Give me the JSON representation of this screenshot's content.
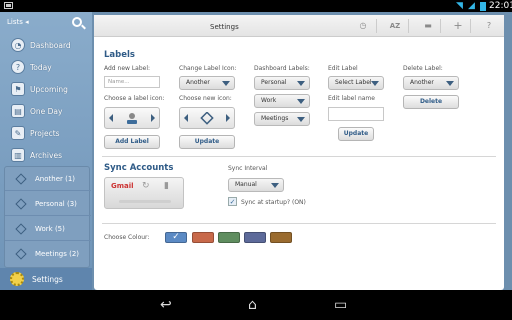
{
  "status": {
    "time": "22:01"
  },
  "sidebar": {
    "header_label": "Lists ◂",
    "items": [
      {
        "label": "Dashboard",
        "icon": "dashboard-icon"
      },
      {
        "label": "Today",
        "icon": "today-icon"
      },
      {
        "label": "Upcoming",
        "icon": "upcoming-icon"
      },
      {
        "label": "One Day",
        "icon": "one-day-icon"
      },
      {
        "label": "Projects",
        "icon": "projects-icon"
      },
      {
        "label": "Archives",
        "icon": "archives-icon"
      }
    ],
    "lists": [
      {
        "label": "Another (1)"
      },
      {
        "label": "Personal (3)"
      },
      {
        "label": "Work (5)"
      },
      {
        "label": "Meetings (2)"
      }
    ],
    "settings_label": "Settings"
  },
  "toolbar": {
    "title": "Settings",
    "sort_label": "AZ"
  },
  "labels": {
    "title": "Labels",
    "add_new_label": "Add new Label:",
    "name_placeholder": "Name...",
    "choose_label_icon": "Choose a label icon:",
    "add_button": "Add Label",
    "change_label_icon": "Change Label Icon:",
    "change_select": "Another",
    "choose_new_icon": "Choose new icon:",
    "update_button": "Update",
    "dashboard_labels": "Dashboard Labels:",
    "dash_select_1": "Personal",
    "dash_select_2": "Work",
    "dash_select_3": "Meetings",
    "edit_label": "Edit Label",
    "edit_select": "Select Label",
    "edit_label_name": "Edit label name",
    "edit_update_button": "Update",
    "delete_label": "Delete Label:",
    "delete_select": "Another",
    "delete_button": "Delete"
  },
  "sync": {
    "title": "Sync Accounts",
    "account": "Gmail",
    "interval_label": "Sync Interval",
    "interval_value": "Manual",
    "startup_label": "Sync at startup? (ON)",
    "startup_checked": true
  },
  "colour": {
    "label": "Choose Colour:",
    "swatches": [
      "#5b8ac4",
      "#c8694a",
      "#5f8d5f",
      "#5d6a9a",
      "#9a6b2f"
    ],
    "selected_index": 0
  },
  "navbar": {
    "back": "↩",
    "home": "⌂",
    "recents": "▭"
  }
}
